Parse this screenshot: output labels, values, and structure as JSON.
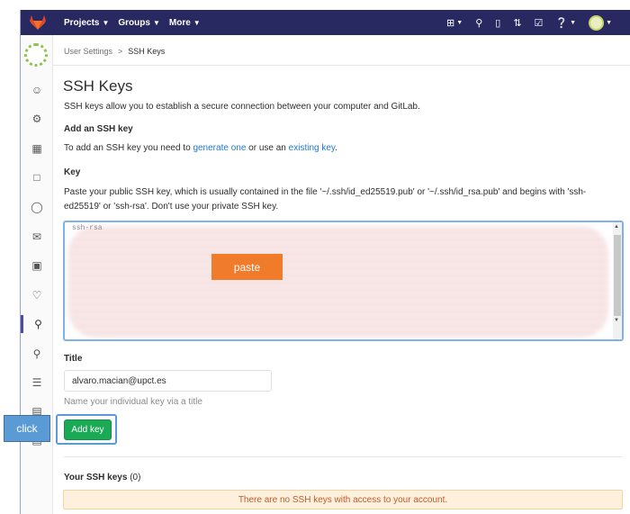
{
  "nav": {
    "projects": "Projects",
    "groups": "Groups",
    "more": "More"
  },
  "breadcrumb": {
    "parent": "User Settings",
    "separator": ">",
    "current": "SSH Keys"
  },
  "page": {
    "title": "SSH Keys",
    "intro": "SSH keys allow you to establish a secure connection between your computer and GitLab."
  },
  "add_section": {
    "heading": "Add an SSH key",
    "text_before": "To add an SSH key you need to ",
    "link_generate": "generate one",
    "text_middle": " or use an ",
    "link_existing": "existing key",
    "text_after": "."
  },
  "key_field": {
    "label": "Key",
    "help": "Paste your public SSH key, which is usually contained in the file '~/.ssh/id_ed25519.pub' or '~/.ssh/id_rsa.pub' and begins with 'ssh-ed25519' or 'ssh-rsa'. Don't use your private SSH key.",
    "value_prefix": "ssh-rsa"
  },
  "annotations": {
    "paste": "paste",
    "click": "click"
  },
  "title_field": {
    "label": "Title",
    "value": "alvaro.macian@upct.es",
    "help": "Name your individual key via a title"
  },
  "add_button": "Add key",
  "keys_list": {
    "heading": "Your SSH keys",
    "count": "(0)",
    "empty": "There are no SSH keys with access to your account."
  },
  "colors": {
    "topbar": "#292961",
    "add_button": "#1aaa55",
    "link": "#1f78d1",
    "paste_tag": "#f07b2b",
    "click_tag": "#5b9bd5",
    "empty_note_bg": "#fdf1dd"
  },
  "icons": [
    "gitlab-logo-icon",
    "plus-icon",
    "search-icon",
    "issues-icon",
    "merge-request-icon",
    "todo-icon",
    "help-icon",
    "avatar"
  ]
}
